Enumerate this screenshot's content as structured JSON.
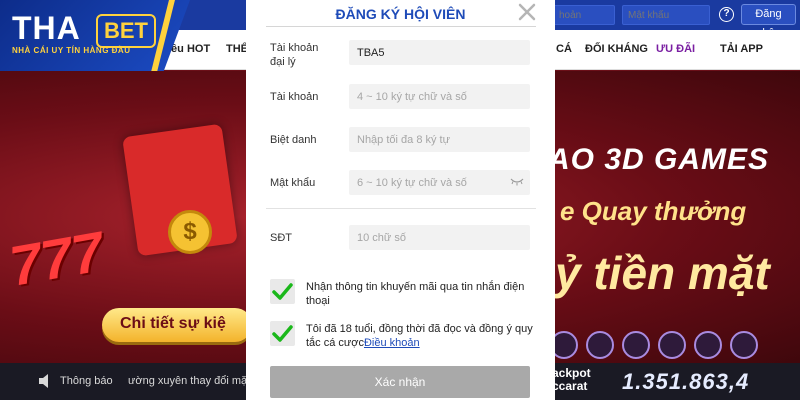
{
  "brand": {
    "logo_main": "THA",
    "logo_accent": "BET",
    "slogan": "NHÀ CÁI UY TÍN HÀNG ĐẦU",
    "accent_color": "#ffd23d",
    "primary_color": "#1a3aa0"
  },
  "header": {
    "username_placeholder": "hoản",
    "password_placeholder": "Mật khẩu",
    "help_icon": "question-circle-icon",
    "login_label": "Đăng nhập"
  },
  "nav": {
    "items": [
      {
        "label": "iều HOT"
      },
      {
        "label": "THỂ"
      },
      {
        "label": "CÁ"
      },
      {
        "label": "ĐỐI KHÁNG"
      },
      {
        "label": "ƯU ĐÃI"
      },
      {
        "label": "TẢI APP"
      }
    ]
  },
  "banner": {
    "slot_text": "777",
    "coin_symbol": "$",
    "cta_label": "Chi tiết sự kiệ",
    "line1": "AO  3D GAMES",
    "line2": "e Quay thưởng",
    "line3": "ỷ tiền mặt"
  },
  "footer": {
    "notice_label": "Thông báo",
    "marquee": "ường xuyên thay đổi mặ",
    "jackpot_label_1": "ackpot",
    "jackpot_label_2": "ccarat",
    "jackpot_value": "1.351.863,4"
  },
  "modal": {
    "title": "ĐĂNG KÝ HỘI VIÊN",
    "close_icon": "close-icon",
    "fields": [
      {
        "label_1": "Tài khoản",
        "label_2": "đại lý",
        "value": "TBA5",
        "placeholder": ""
      },
      {
        "label_1": "Tài khoản",
        "label_2": "",
        "value": "",
        "placeholder": "4 ~ 10 ký tự chữ và số"
      },
      {
        "label_1": "Biệt danh",
        "label_2": "",
        "value": "",
        "placeholder": "Nhập tối đa 8 ký tự"
      },
      {
        "label_1": "Mật khẩu",
        "label_2": "",
        "value": "",
        "placeholder": "6 ~ 10 ký tự chữ và số"
      },
      {
        "label_1": "SĐT",
        "label_2": "",
        "value": "",
        "placeholder": "10 chữ số"
      }
    ],
    "checkboxes": [
      {
        "checked": true,
        "text": "Nhận thông tin khuyến mãi qua tin nhắn điện thoại"
      },
      {
        "checked": true,
        "text": "Tôi đã 18 tuổi, đồng thời đã đọc và đồng ý quy tắc cá cược",
        "link": "Điều khoản"
      }
    ],
    "check_color": "#1bb81b",
    "submit_label": "Xác nhận"
  }
}
